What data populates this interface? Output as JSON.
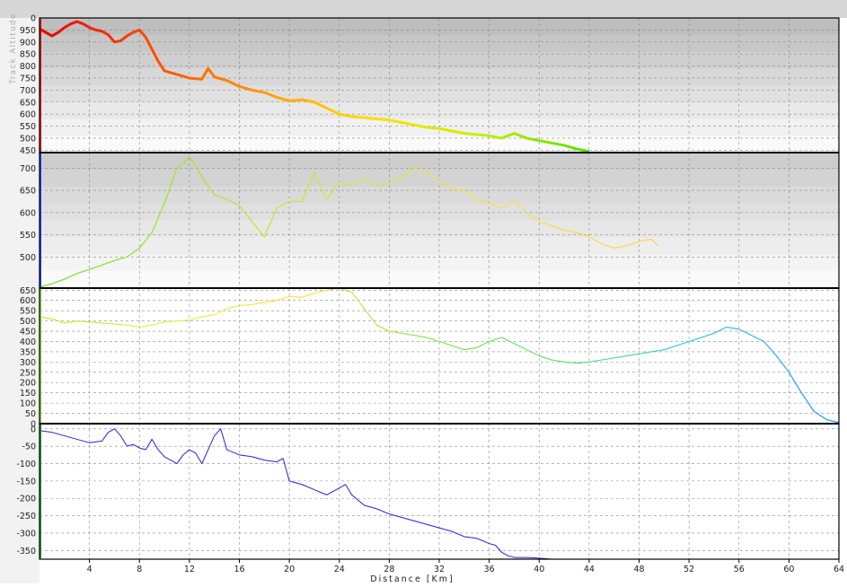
{
  "chart_data": [
    {
      "type": "line",
      "ylabel": "Track Altitude",
      "ylim": [
        440,
        1000
      ],
      "yticks": [
        0,
        950,
        900,
        850,
        800,
        750,
        700,
        650,
        600,
        550,
        500,
        450
      ],
      "x": [
        0,
        0.5,
        1,
        1.5,
        2,
        2.5,
        3,
        3.5,
        4,
        4.5,
        5,
        5.5,
        6,
        6.5,
        7,
        7.5,
        8,
        8.5,
        9,
        9.5,
        10,
        11,
        12,
        13,
        13.5,
        14,
        15,
        16,
        17,
        18,
        19,
        20,
        21,
        22,
        23,
        24,
        25,
        26,
        27,
        28,
        29,
        30,
        31,
        32,
        33,
        34,
        35,
        36,
        37,
        38,
        39,
        40,
        41,
        42,
        43,
        44
      ],
      "values": [
        955,
        940,
        925,
        940,
        960,
        975,
        985,
        975,
        960,
        950,
        945,
        930,
        900,
        905,
        925,
        940,
        950,
        920,
        870,
        820,
        780,
        765,
        750,
        745,
        790,
        755,
        740,
        715,
        700,
        690,
        670,
        655,
        660,
        650,
        625,
        600,
        590,
        585,
        580,
        575,
        565,
        555,
        545,
        540,
        530,
        520,
        515,
        510,
        500,
        520,
        500,
        490,
        480,
        470,
        455,
        445
      ],
      "color_stops": [
        "#e60000",
        "#ff4a00",
        "#ff9a00",
        "#ffe000",
        "#c8f000",
        "#55e000"
      ]
    },
    {
      "type": "line",
      "ylim": [
        430,
        735
      ],
      "yticks": [
        700,
        650,
        600,
        550,
        500
      ],
      "x": [
        0,
        1,
        2,
        3,
        4,
        5,
        6,
        7,
        8,
        9,
        10,
        11,
        11.5,
        12,
        12.5,
        13,
        14,
        15,
        16,
        17,
        18,
        19,
        20,
        21,
        22,
        23,
        24,
        25,
        26,
        27,
        28,
        29,
        30,
        31,
        32,
        33,
        34,
        35,
        36,
        37,
        38,
        39,
        40,
        41,
        42,
        43,
        44,
        45,
        46,
        47,
        48,
        49,
        49.5
      ],
      "values": [
        432,
        440,
        450,
        463,
        472,
        482,
        492,
        500,
        520,
        555,
        620,
        700,
        710,
        725,
        705,
        680,
        640,
        630,
        615,
        580,
        545,
        610,
        625,
        625,
        690,
        630,
        670,
        660,
        675,
        660,
        665,
        680,
        700,
        690,
        670,
        655,
        650,
        630,
        620,
        610,
        625,
        600,
        580,
        570,
        560,
        555,
        545,
        530,
        520,
        525,
        535,
        540,
        525
      ],
      "color_stops": [
        "#6ddf2a",
        "#b5ea2a",
        "#f0e640",
        "#ffd44a"
      ]
    },
    {
      "type": "line",
      "ylim": [
        0,
        660
      ],
      "yticks": [
        650,
        600,
        550,
        500,
        450,
        400,
        350,
        300,
        250,
        200,
        150,
        100,
        50,
        0
      ],
      "x": [
        0,
        1,
        2,
        3,
        4,
        5,
        6,
        7,
        8,
        9,
        10,
        11,
        12,
        13,
        14,
        15,
        16,
        17,
        18,
        19,
        20,
        21,
        22,
        23,
        24,
        25,
        26,
        27,
        28,
        29,
        30,
        31,
        32,
        33,
        34,
        35,
        36,
        37,
        38,
        39,
        40,
        41,
        42,
        43,
        44,
        45,
        46,
        47,
        48,
        49,
        50,
        51,
        52,
        53,
        54,
        55,
        56,
        57,
        58,
        59,
        60,
        61,
        62,
        63,
        64
      ],
      "values": [
        520,
        510,
        490,
        500,
        495,
        490,
        485,
        480,
        470,
        480,
        495,
        500,
        505,
        520,
        530,
        560,
        575,
        580,
        590,
        600,
        620,
        615,
        635,
        650,
        660,
        640,
        560,
        480,
        450,
        440,
        430,
        420,
        400,
        380,
        360,
        370,
        400,
        420,
        390,
        360,
        330,
        310,
        300,
        295,
        300,
        310,
        320,
        330,
        340,
        350,
        360,
        380,
        400,
        420,
        440,
        470,
        460,
        430,
        400,
        330,
        250,
        150,
        60,
        20,
        5
      ],
      "color_stops": [
        "#b8ed2e",
        "#e8f04a",
        "#ffe043",
        "#7ae84d",
        "#5fe07a",
        "#31c8e8",
        "#1e90ff"
      ]
    },
    {
      "type": "line",
      "xlabel": "Distance [Km]",
      "ylim": [
        -375,
        15
      ],
      "yticks": [
        0,
        -50,
        -100,
        -150,
        -200,
        -250,
        -300,
        -350
      ],
      "xticks": [
        4,
        8,
        12,
        16,
        20,
        24,
        28,
        32,
        36,
        40,
        44,
        48,
        52,
        56,
        60,
        64
      ],
      "xlim": [
        0,
        64
      ],
      "x": [
        0,
        1,
        2,
        3,
        4,
        5,
        5.5,
        6,
        6.5,
        7,
        7.5,
        8,
        8.5,
        9,
        9.5,
        10,
        10.5,
        11,
        11.5,
        12,
        12.5,
        13,
        13.5,
        14,
        14.5,
        15,
        16,
        17,
        18,
        19,
        19.5,
        20,
        21,
        22,
        23,
        24,
        24.5,
        25,
        26,
        27,
        28,
        29,
        30,
        31,
        32,
        33,
        34,
        35,
        36,
        36.5,
        37,
        37.5,
        38,
        39,
        40,
        41
      ],
      "values": [
        -5,
        -10,
        -20,
        -30,
        -40,
        -35,
        -10,
        0,
        -20,
        -50,
        -45,
        -55,
        -60,
        -30,
        -60,
        -80,
        -90,
        -100,
        -75,
        -60,
        -70,
        -100,
        -60,
        -20,
        0,
        -60,
        -75,
        -80,
        -90,
        -95,
        -85,
        -150,
        -160,
        -175,
        -190,
        -170,
        -160,
        -190,
        -220,
        -230,
        -245,
        -255,
        -265,
        -275,
        -285,
        -295,
        -310,
        -315,
        -330,
        -335,
        -355,
        -365,
        -370,
        -370,
        -372,
        -375
      ],
      "color": "#2323d8"
    }
  ]
}
